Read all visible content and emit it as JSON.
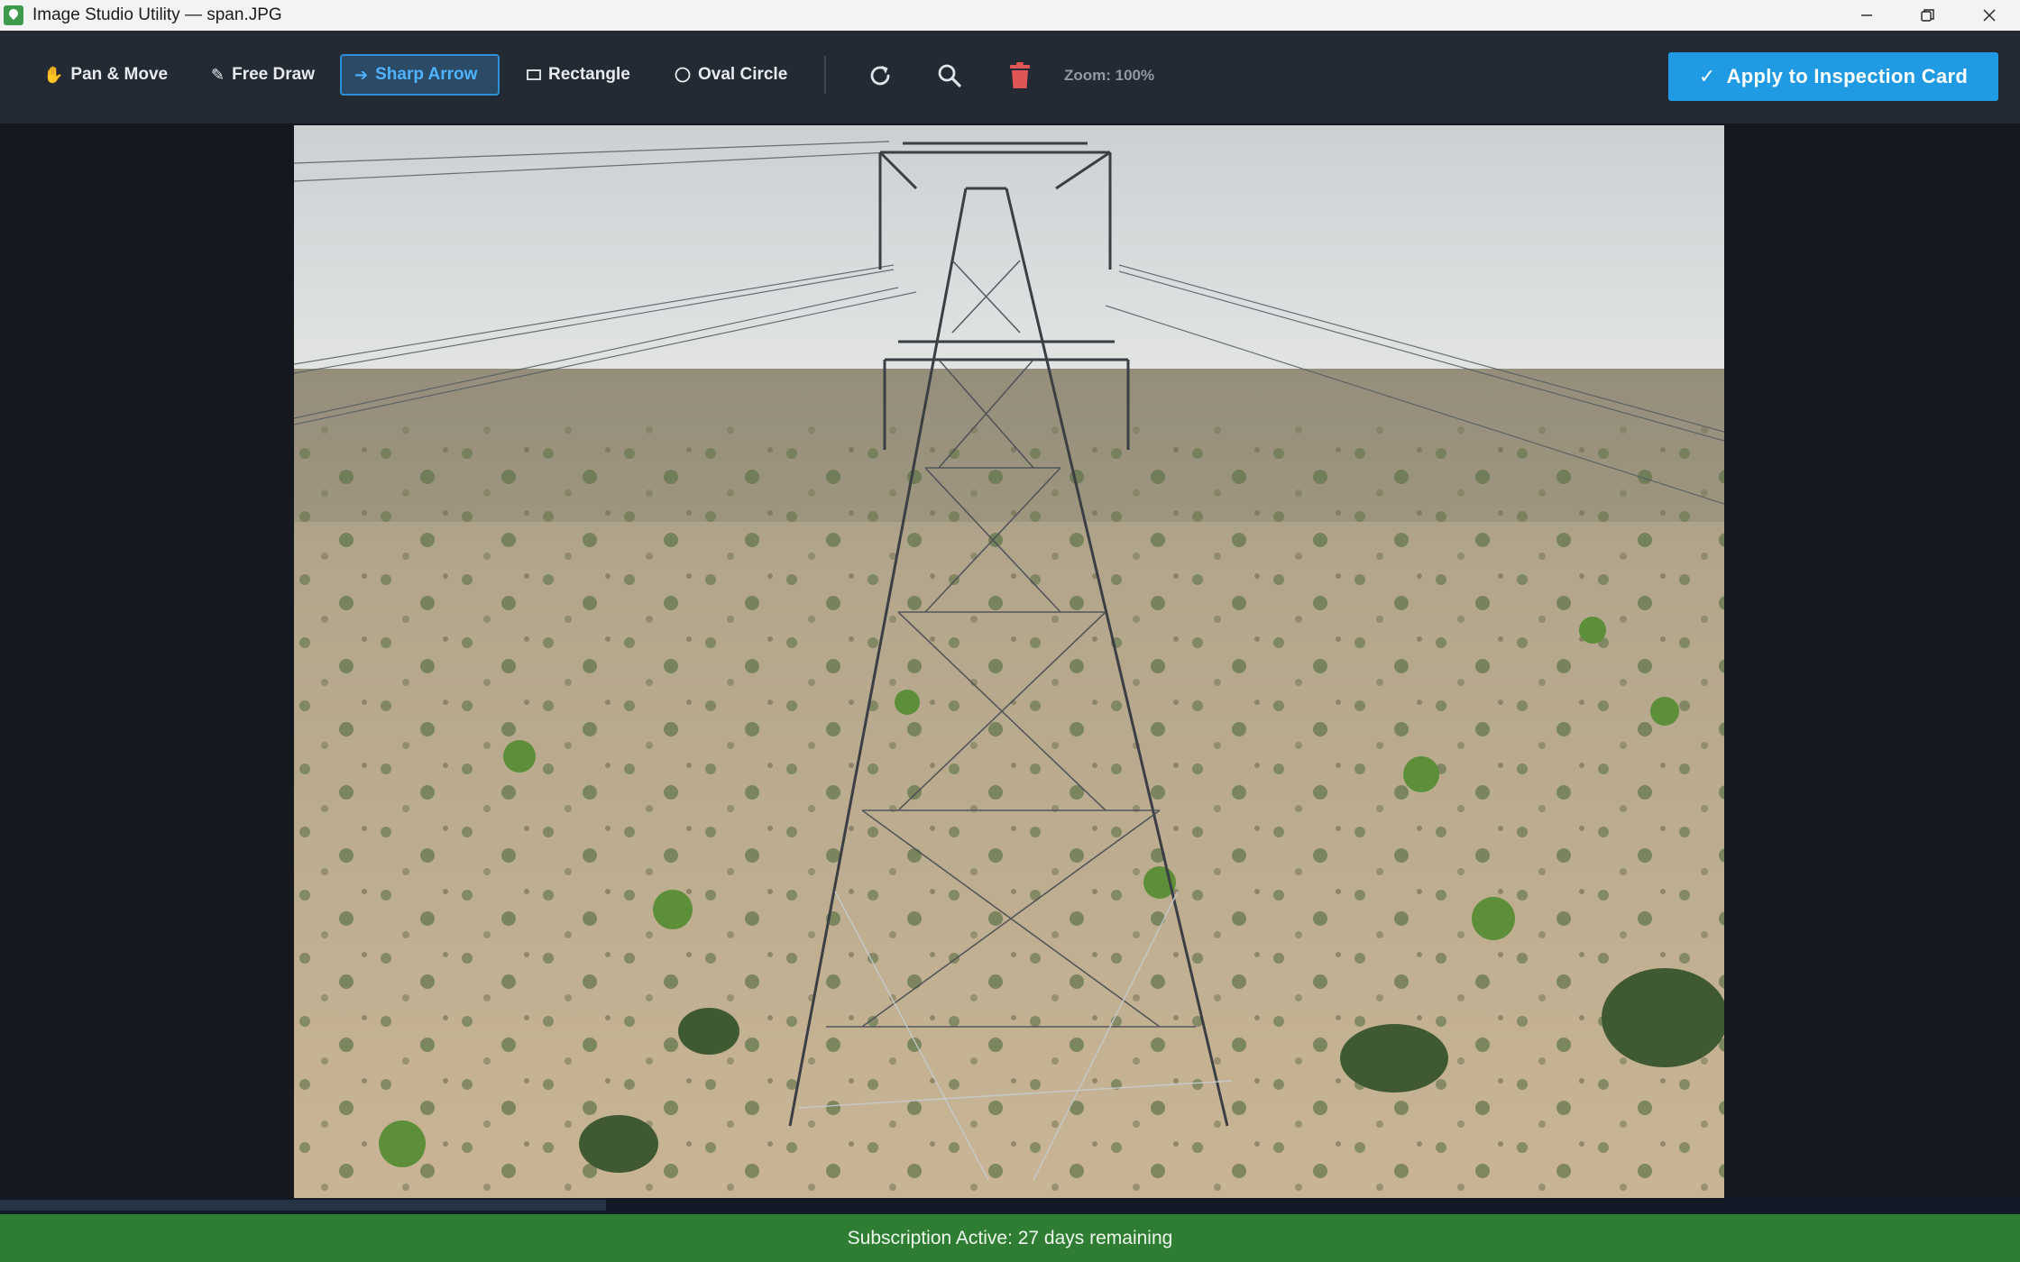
{
  "window": {
    "title": "Image Studio Utility — span.JPG"
  },
  "toolbar": {
    "tools": [
      {
        "label": "Pan & Move",
        "icon": "hand-icon"
      },
      {
        "label": "Free Draw",
        "icon": "pencil-icon"
      },
      {
        "label": "Sharp Arrow",
        "icon": "arrow-right-icon",
        "active": true
      },
      {
        "label": "Rectangle",
        "icon": "rectangle-icon"
      },
      {
        "label": "Oval Circle",
        "icon": "circle-icon"
      }
    ],
    "actions": [
      {
        "name": "reset-rotate-icon"
      },
      {
        "name": "search-icon"
      },
      {
        "name": "trash-icon",
        "color": "#e05555"
      }
    ],
    "zoom_label": "Zoom: 100%",
    "apply_label": "Apply to Inspection Card",
    "apply_color": "#1f9ae3",
    "active_color": "#2e8fd6"
  },
  "status": {
    "text": "Subscription Active: 27 days remaining",
    "color": "#2f7d32"
  }
}
